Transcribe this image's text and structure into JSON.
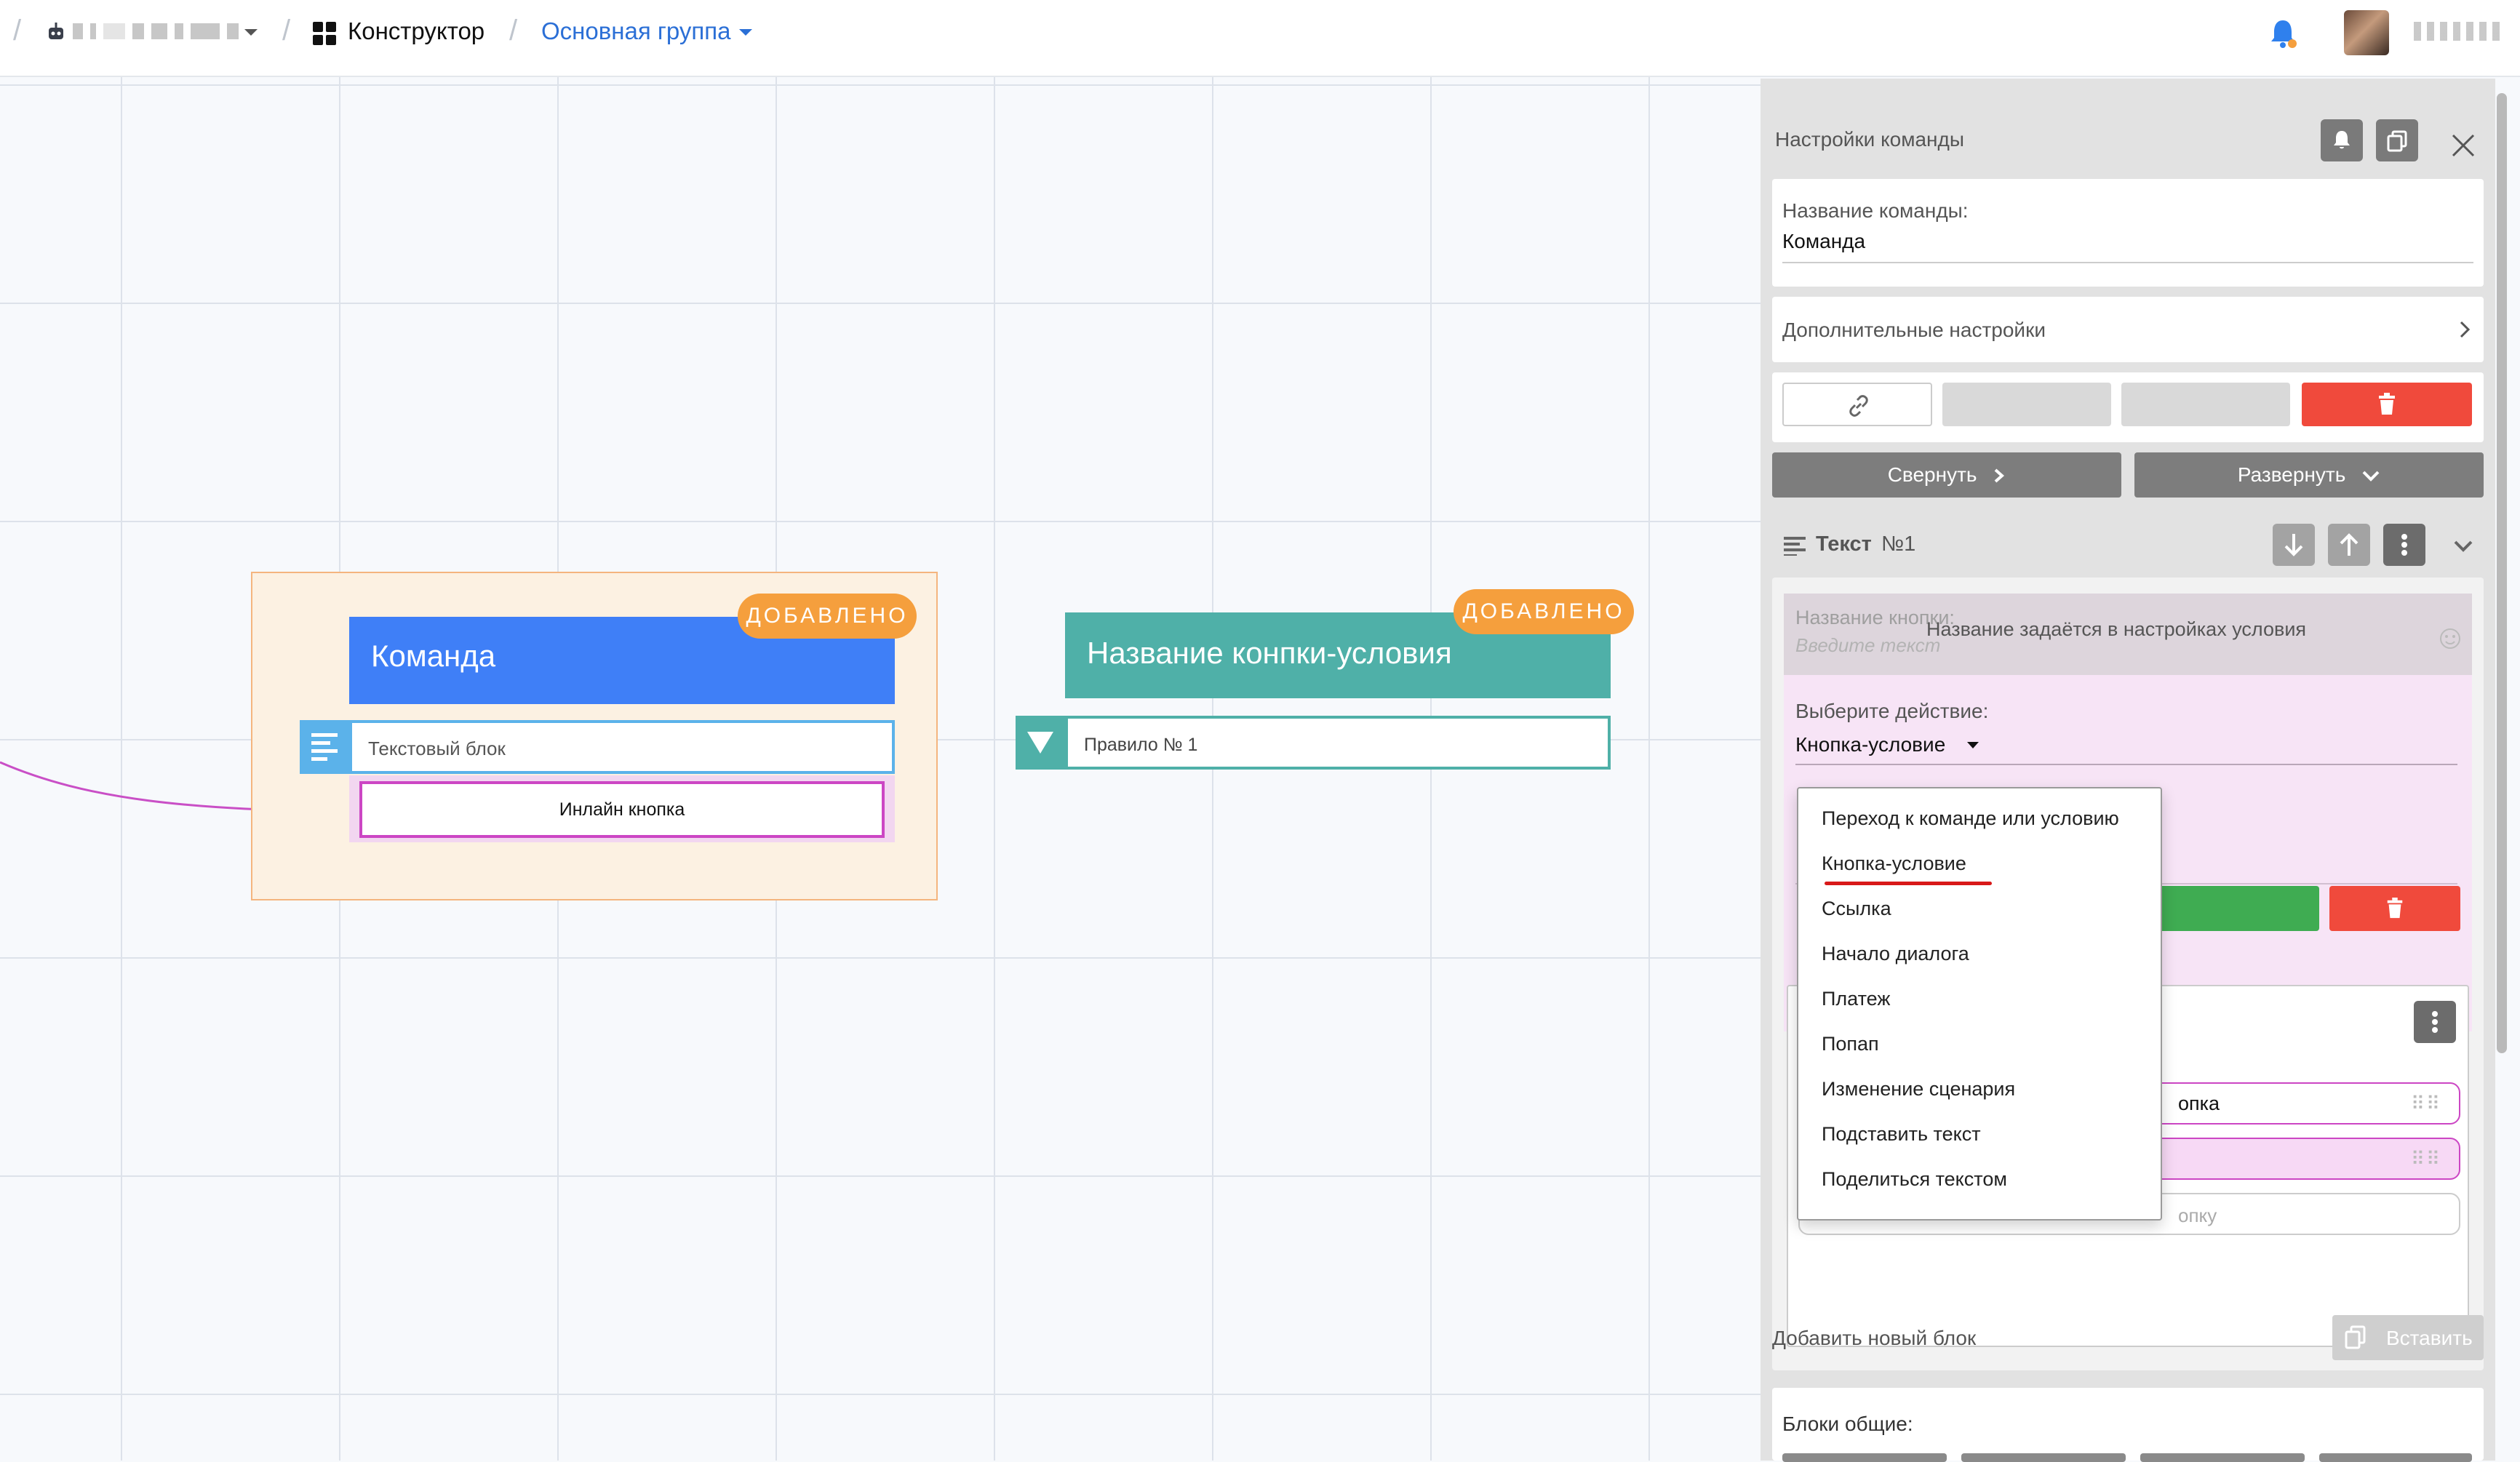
{
  "breadcrumb": {
    "section": "Конструктор",
    "group": "Основная группа"
  },
  "canvas": {
    "command_node": {
      "title": "Команда",
      "badge": "ДОБАВЛЕНО",
      "text_block": "Текстовый блок",
      "inline_button": "Инлайн кнопка"
    },
    "condition_node": {
      "title": "Название конпки-условия",
      "badge": "ДОБАВЛЕНО",
      "rule": "Правило № 1"
    }
  },
  "panel": {
    "title": "Настройки команды",
    "name_label": "Название команды:",
    "name_value": "Команда",
    "advanced_settings": "Дополнительные настройки",
    "collapse_label": "Свернуть",
    "expand_label": "Развернуть",
    "text_block": {
      "label": "Текст",
      "number": "№1"
    },
    "button_name_label": "Название кнопки:",
    "button_name_placeholder": "Введите текст",
    "button_name_notice": "Название задаётся в настройках условия",
    "action_label": "Выберите действие:",
    "action_value": "Кнопка-условие",
    "action_options": [
      "Переход к команде или условию",
      "Кнопка-условие",
      "Ссылка",
      "Начало диалога",
      "Платеж",
      "Попап",
      "Изменение сценария",
      "Подставить текст",
      "Поделиться текстом"
    ],
    "partial_text_1": "опка",
    "partial_text_2": "опку",
    "add_block_label": "Добавить новый блок",
    "paste_label": "Вставить",
    "common_blocks_label": "Блоки общие:"
  },
  "colors": {
    "command_blue": "#3f7ff7",
    "badge_orange": "#f59f3d",
    "condition_teal": "#4fb0a8",
    "delete_red": "#f04a3c",
    "confirm_green": "#3fac52",
    "accent_link": "#2b6fd6"
  }
}
